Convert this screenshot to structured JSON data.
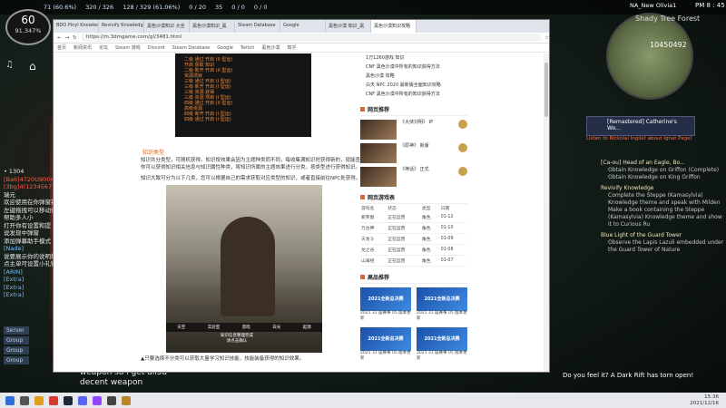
{
  "hud": {
    "level": "60",
    "level_pct": "91.347%",
    "stat_items": [
      "71 (60.6%)",
      "320 / 326",
      "128 / 329 (61.06%)",
      "0 / 20",
      "35",
      "0 / 0",
      "0 / 0"
    ],
    "user": "NA_New Olivia1",
    "clock": "PM 8 : 45",
    "minimap_place": "Shady Tree Forest",
    "minimap_coords": "10450492"
  },
  "chat": {
    "lines": [
      {
        "text": "• 1304",
        "tone": "white"
      },
      {
        "text": "[Ba6]4720U9004 重新设置 [重填]",
        "tone": "red"
      },
      {
        "text": "[3bg]4(1234567) 消息 [重填]",
        "tone": "red"
      },
      {
        "text": "瑞元",
        "tone": "white"
      },
      {
        "text": "欢迎使用在你弹窗提供",
        "tone": "white"
      },
      {
        "text": "左键拖拽可以移动位置，右键可打开",
        "tone": "white"
      },
      {
        "text": "帮助多人小",
        "tone": "white"
      },
      {
        "text": "打开你有设置和提",
        "tone": "white"
      },
      {
        "text": "说发现中弹窗",
        "tone": "white"
      },
      {
        "text": "添加弹幕助手模式",
        "tone": "white"
      },
      {
        "text": "[Nade]",
        "tone": "blue"
      },
      {
        "text": "说要展示你的说明和，道具，宠物",
        "tone": "white"
      },
      {
        "text": "点主单可设置小礼物种",
        "tone": "white"
      },
      {
        "text": "[ARIN]",
        "tone": "blue"
      },
      {
        "text": "[Extra]",
        "tone": "blue"
      },
      {
        "text": "[Extra]",
        "tone": "blue"
      },
      {
        "text": "[Extra]",
        "tone": "blue"
      }
    ],
    "tabs": [
      "Server",
      "Group",
      "Group",
      "Group"
    ],
    "bottom_line1": "weapon so i get all5a",
    "bottom_line2": "decent weapon"
  },
  "quest": {
    "card_title": "[Remastered] Catherine's Wo...",
    "card_sub": "Listen to Nickolai Ingilet about Ignat Pagel.",
    "items": [
      {
        "title": "[Ca-ou] Head of an Eagle, Bo...",
        "subs": [
          "Obtain Knowledge on Griffon (Complete)",
          "Obtain Knowledge on King Griffon"
        ]
      },
      {
        "title": "Revivify Knowledge",
        "subs": [
          "Complete the Steppe (Kamasylvia) Knowledge theme and speak with Milden",
          "Make a book containing the Steppe (Kamasylvia) Knowledge theme and show it to Curious Ru"
        ]
      },
      {
        "title": "Blue Light of the Guard Tower",
        "subs": [
          "Observe the Lapis Lazuli embedded under the Guard Tower of Nature"
        ]
      }
    ],
    "rift_message": "Do you feel it? A Dark Rift has torn open!"
  },
  "browser": {
    "tabs": [
      "BDO Pinyl Knowledge",
      "Revivify Knowledge",
      "黑色沙漠知识 大全",
      "黑色沙漠知识_黑",
      "Steam Database",
      "Google",
      "黑色沙漠 知识_黑",
      "黑色沙漠知识攻略"
    ],
    "address": "https://m.3dmgame.com/gl/3481.html",
    "bookmarks": [
      "首页",
      "新闻资讯",
      "论坛",
      "Steam 游戏",
      "Discord",
      "Steam Database",
      "Google",
      "Twitch",
      "黑色沙漠",
      "知乎"
    ],
    "shot_top_lines": [
      "二级 通过 开启 (II 型运)",
      "开启 获取 知识",
      "二级 新开 开启 (II 型运)",
      "资源项目",
      "三级 通过 开启 (I 型运)",
      "三级 新开 开启 (I 型运)",
      "三级 资源 获得",
      "三级 资源 项目 (I 型运)",
      "四级 通过 开启 (II 型运)",
      "高级资源",
      "四级 新开 开启 (I 型运)",
      "四级 通过 开启 (I 型运)"
    ],
    "heading": "知识类型",
    "para1": "知识共分类型，可随机获得。知识按效果会因为主题种类而不同，每收集满知识时获得新的，就能查看知识。在此你可以获得知识相关信息与知识属性种类，将知识所属的主题效果进行分类，按类型进行获得知识。",
    "para2": "知识大致可分为以下几类，您可以根据自己的需求获取对应类型的知识，或者直接前往NPC处获得。",
    "shot_options": [
      "天空",
      "实验室",
      "黑暗",
      "白光",
      "起源"
    ],
    "shot_caption1": "知识信息整理完成",
    "shot_caption2": "请点击确认",
    "caption": "▲只要选择不分类可以获取大量学习知识技能，技能装备获得的知识效果。"
  },
  "sidebar": {
    "top_links": [
      "1万1260游戏 知识",
      "CNF 黑色沙漠中所有的知识获得方法",
      "黑色沙漠 攻略",
      "白天 NPC 2020 最新版全面知识攻略",
      "CNF 黑色沙漠中所有的知识获得方法"
    ],
    "section1": "网页推荐",
    "news": [
      {
        "text": "《大侠刘明》 IP",
        "meta": "00"
      },
      {
        "text": "《原神》 新版",
        "meta": "00"
      },
      {
        "text": "《神话》 正式",
        "meta": "00"
      }
    ],
    "section2": "网页游戏表",
    "table_headers": [
      "游戏名",
      "状态",
      "类型",
      "日期"
    ],
    "table_rows": [
      [
        "新笑傲",
        "正在运营",
        "角色",
        "01-12"
      ],
      [
        "万古神",
        "正在运营",
        "角色",
        "01-10"
      ],
      [
        "天龙斗",
        "正在运营",
        "角色",
        "01-09"
      ],
      [
        "龙之谷",
        "正在运营",
        "角色",
        "01-08"
      ],
      [
        "山海经",
        "正在运营",
        "角色",
        "01-07"
      ]
    ],
    "section3": "高品推荐",
    "videos": [
      {
        "title": "2021全新总决赛",
        "text": "2021 31 届赛事 05 版本更新"
      },
      {
        "title": "2021全新总决赛",
        "text": "2021 31 届赛事 05 版本更新"
      },
      {
        "title": "2021全新总决赛",
        "text": "2021 31 届赛事 05 版本更新"
      },
      {
        "title": "2021全新总决赛",
        "text": "2021 31 届赛事 05 版本更新"
      }
    ]
  },
  "taskbar": {
    "time": "15:36",
    "date": "2021/12/16"
  },
  "game_overlay": {
    "skill_label": "最新活动"
  }
}
